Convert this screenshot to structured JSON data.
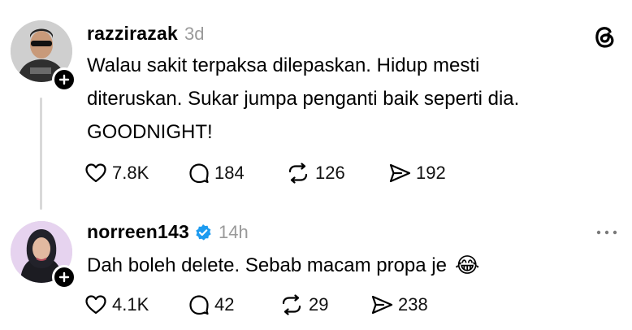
{
  "posts": [
    {
      "username": "razzirazak",
      "timestamp": "3d",
      "verified": false,
      "text": "Walau sakit terpaksa dilepaskan. Hidup mesti\nditeruskan. Sukar jumpa penganti baik seperti dia.\nGOODNIGHT!",
      "emoji": "",
      "likes": "7.8K",
      "replies": "184",
      "reposts": "126",
      "shares": "192"
    },
    {
      "username": "norreen143",
      "timestamp": "14h",
      "verified": true,
      "text": "Dah boleh delete. Sebab macam propa je",
      "emoji": "😂",
      "likes": "4.1K",
      "replies": "42",
      "reposts": "29",
      "shares": "238"
    }
  ],
  "icons": {
    "app_logo": "threads-logo-icon",
    "more": "more-options-icon",
    "like": "heart-icon",
    "reply": "comment-icon",
    "repost": "repost-icon",
    "share": "share-icon",
    "follow": "plus-icon",
    "verified": "verified-badge-icon"
  },
  "colors": {
    "verified": "#1d9bf0",
    "muted": "#9a9a9a",
    "thread_line": "#d9d9d9"
  }
}
